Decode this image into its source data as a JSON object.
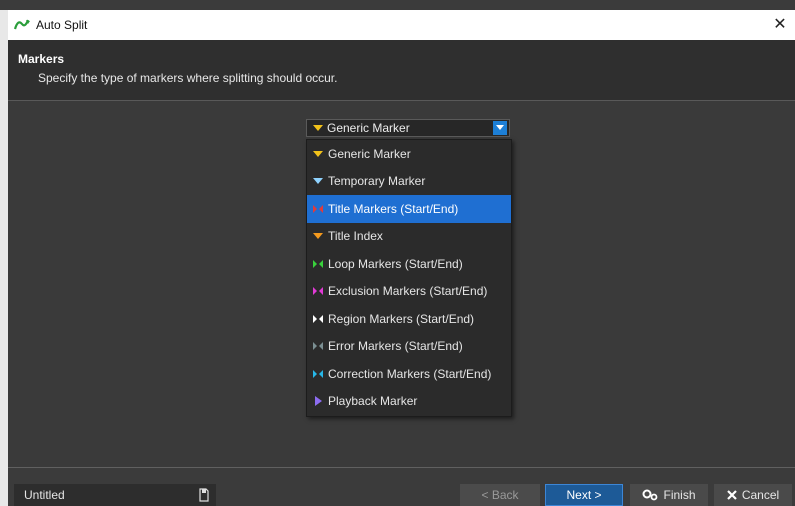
{
  "window": {
    "title": "Auto Split",
    "close_glyph": "✕"
  },
  "header": {
    "title": "Markers",
    "subtitle": "Specify the type of markers where splitting should occur."
  },
  "combo": {
    "selected": "Generic Marker"
  },
  "dropdown": {
    "options": [
      {
        "label": "Generic Marker",
        "icon": "marker-down-triangle-yellow-icon",
        "color": "#f2c21a"
      },
      {
        "label": "Temporary Marker",
        "icon": "marker-down-triangle-lightblue-icon",
        "color": "#8fd3ff"
      },
      {
        "label": "Title Markers (Start/End)",
        "icon": "marker-bowtie-red-icon",
        "color": "#e23b3b"
      },
      {
        "label": "Title Index",
        "icon": "marker-down-triangle-orange-icon",
        "color": "#f59a1e"
      },
      {
        "label": "Loop Markers (Start/End)",
        "icon": "marker-bowtie-green-icon",
        "color": "#39d13c"
      },
      {
        "label": "Exclusion Markers (Start/End)",
        "icon": "marker-bowtie-magenta-icon",
        "color": "#e23ad6"
      },
      {
        "label": "Region Markers (Start/End)",
        "icon": "marker-bowtie-white-icon",
        "color": "#ffffff"
      },
      {
        "label": "Error Markers (Start/End)",
        "icon": "marker-bowtie-gray-icon",
        "color": "#7b8f92"
      },
      {
        "label": "Correction Markers (Start/End)",
        "icon": "marker-bowtie-cyan-icon",
        "color": "#27b7e8"
      },
      {
        "label": "Playback Marker",
        "icon": "marker-right-triangle-purple-icon",
        "color": "#8c6cf0"
      }
    ],
    "selected_index": 2
  },
  "status": {
    "text": "Untitled"
  },
  "buttons": {
    "back": "< Back",
    "next": "Next >",
    "finish": "Finish",
    "cancel": "Cancel"
  },
  "colors": {
    "accent": "#1f6fd2",
    "background": "#3b3b3b"
  }
}
